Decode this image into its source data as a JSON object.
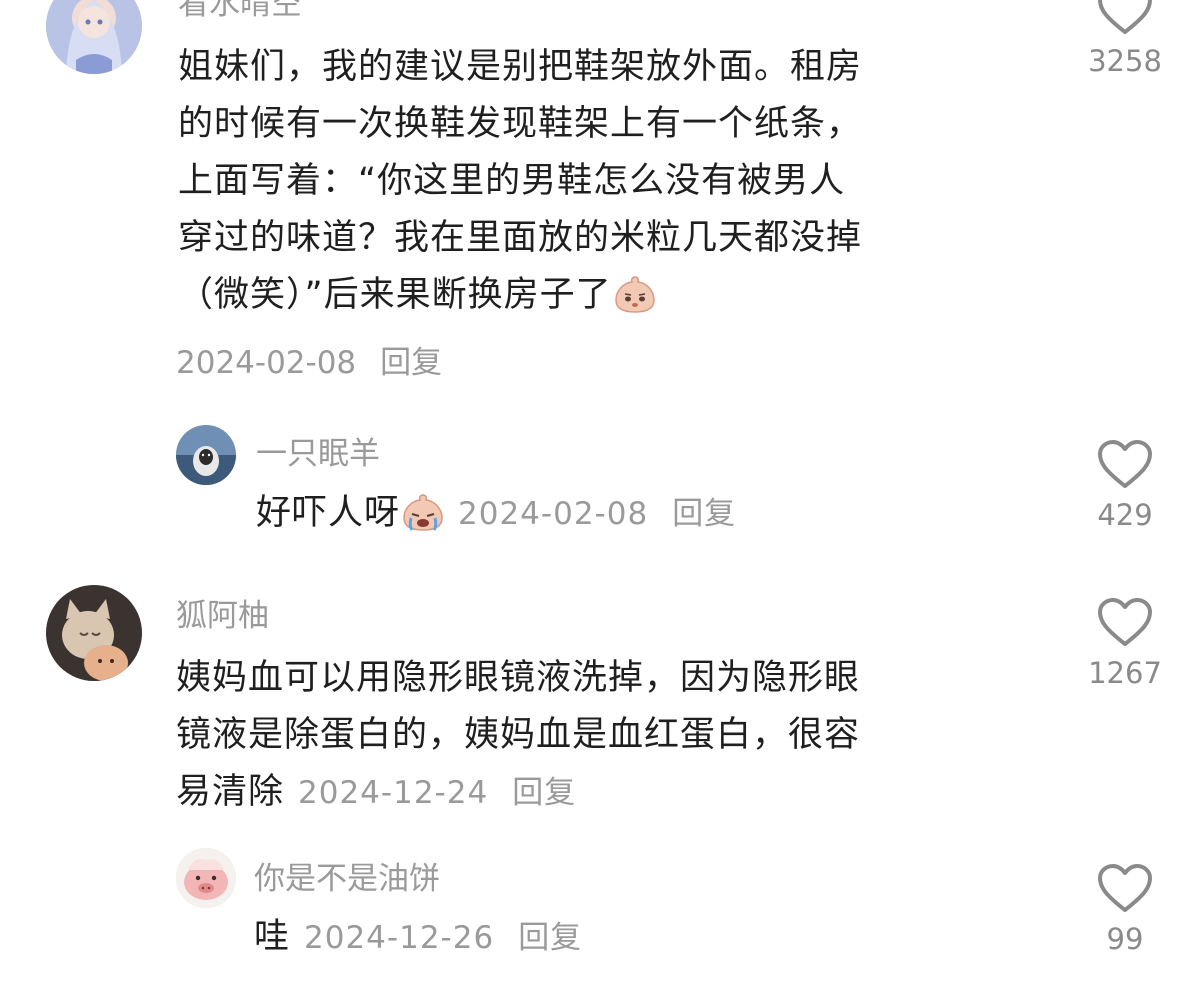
{
  "colors": {
    "text": "#1f1f1f",
    "meta": "#9a9a9a",
    "heart_outline": "#8a8a8a"
  },
  "comments": [
    {
      "username": "看水晴空",
      "avatar_icon": "anime-girl-avatar",
      "lines": [
        "姐妹们，我的建议是别把鞋架放外面。租房",
        "的时候有一次换鞋发现鞋架上有一个纸条，",
        "上面写着：“你这里的男鞋怎么没有被男人",
        "穿过的味道？我在里面放的米粒几天都没掉",
        "（微笑）”后来果断换房子了"
      ],
      "emoji": "worried-face-emoji",
      "date": "2024-02-08",
      "reply_label": "回复",
      "likes": "3258"
    },
    {
      "username": "一只眠羊",
      "avatar_icon": "sheep-avatar",
      "lines": [
        "好吓人呀"
      ],
      "emoji": "crying-face-emoji",
      "date": "2024-02-08",
      "reply_label": "回复",
      "likes": "429"
    },
    {
      "username": "狐阿柚",
      "avatar_icon": "cat-avatar",
      "lines": [
        "姨妈血可以用隐形眼镜液洗掉，因为隐形眼",
        "镜液是除蛋白的，姨妈血是血红蛋白，很容",
        "易清除"
      ],
      "date": "2024-12-24",
      "reply_label": "回复",
      "likes": "1267"
    },
    {
      "username": "你是不是油饼",
      "avatar_icon": "pig-avatar",
      "lines": [
        "哇"
      ],
      "date": "2024-12-26",
      "reply_label": "回复",
      "likes": "99"
    }
  ]
}
